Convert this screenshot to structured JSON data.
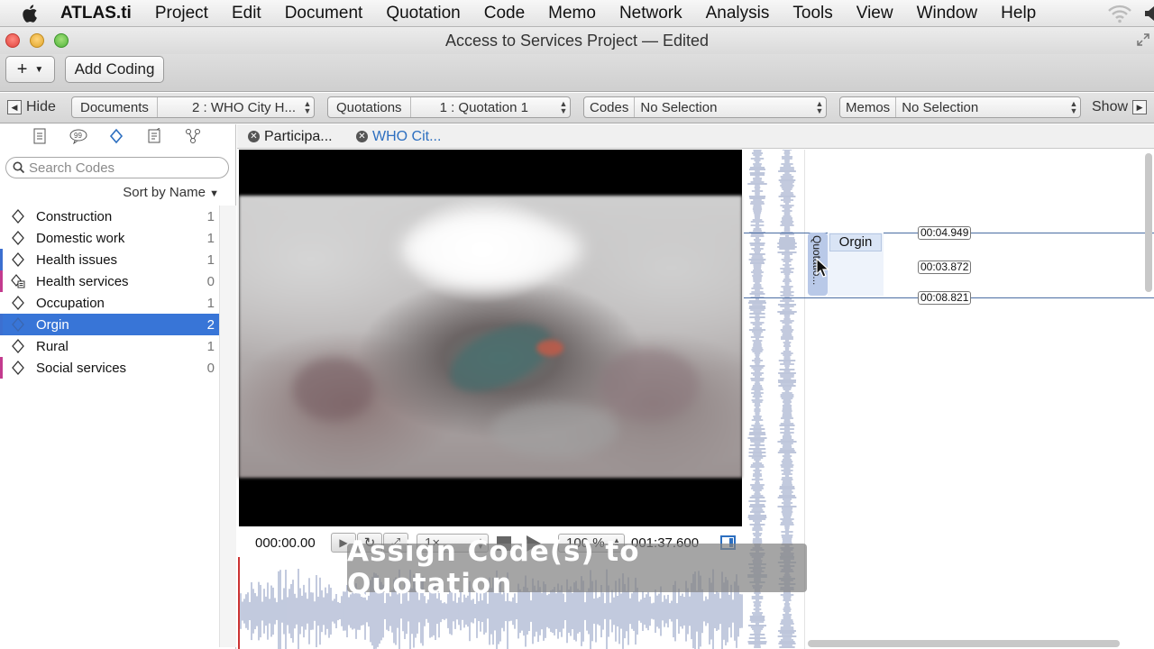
{
  "menubar": {
    "app_name": "ATLAS.ti",
    "items": [
      "Project",
      "Edit",
      "Document",
      "Quotation",
      "Code",
      "Memo",
      "Network",
      "Analysis",
      "Tools",
      "View",
      "Window",
      "Help"
    ]
  },
  "window": {
    "title": "Access to Services Project — Edited"
  },
  "toolbar": {
    "add_label": "+",
    "add_coding_label": "Add Coding"
  },
  "navbar": {
    "hide_label": "Hide",
    "show_label": "Show",
    "documents": {
      "label": "Documents",
      "value": "2 : WHO City H..."
    },
    "quotations": {
      "label": "Quotations",
      "value": "1 : Quotation 1"
    },
    "codes": {
      "label": "Codes",
      "value": "No Selection"
    },
    "memos": {
      "label": "Memos",
      "value": "No Selection"
    }
  },
  "sidebar": {
    "search_placeholder": "Search Codes",
    "sort_label": "Sort by Name",
    "codes": [
      {
        "name": "Construction",
        "count": "1",
        "color": "",
        "selected": false,
        "icon": "diamond-icon"
      },
      {
        "name": "Domestic work",
        "count": "1",
        "color": "",
        "selected": false,
        "icon": "diamond-icon"
      },
      {
        "name": "Health issues",
        "count": "1",
        "color": "#3c6fd0",
        "selected": false,
        "icon": "diamond-icon"
      },
      {
        "name": "Health services",
        "count": "0",
        "color": "#c33b8e",
        "selected": false,
        "icon": "diamond-memo-icon"
      },
      {
        "name": "Occupation",
        "count": "1",
        "color": "",
        "selected": false,
        "icon": "diamond-icon"
      },
      {
        "name": "Orgin",
        "count": "2",
        "color": "#3c6fd0",
        "selected": true,
        "icon": "diamond-icon"
      },
      {
        "name": "Rural",
        "count": "1",
        "color": "",
        "selected": false,
        "icon": "diamond-icon"
      },
      {
        "name": "Social services",
        "count": "0",
        "color": "#c33b8e",
        "selected": false,
        "icon": "diamond-icon"
      }
    ]
  },
  "doc_tabs": [
    {
      "label": "Participa...",
      "active": false
    },
    {
      "label": "WHO Cit...",
      "active": true
    }
  ],
  "transport": {
    "time_start": "000:00.00",
    "speed": "1×",
    "zoom": "100 %",
    "time_end": "001:37.600"
  },
  "margin": {
    "time_labels": [
      "00:04.949",
      "00:03.872",
      "00:08.821"
    ],
    "quotation_label": "Quotatio...",
    "code_label": "Orgin"
  },
  "caption": "Assign Code(s) to Quotation",
  "colors": {
    "selection": "#3875d7",
    "accent": "#2d6fc0"
  }
}
